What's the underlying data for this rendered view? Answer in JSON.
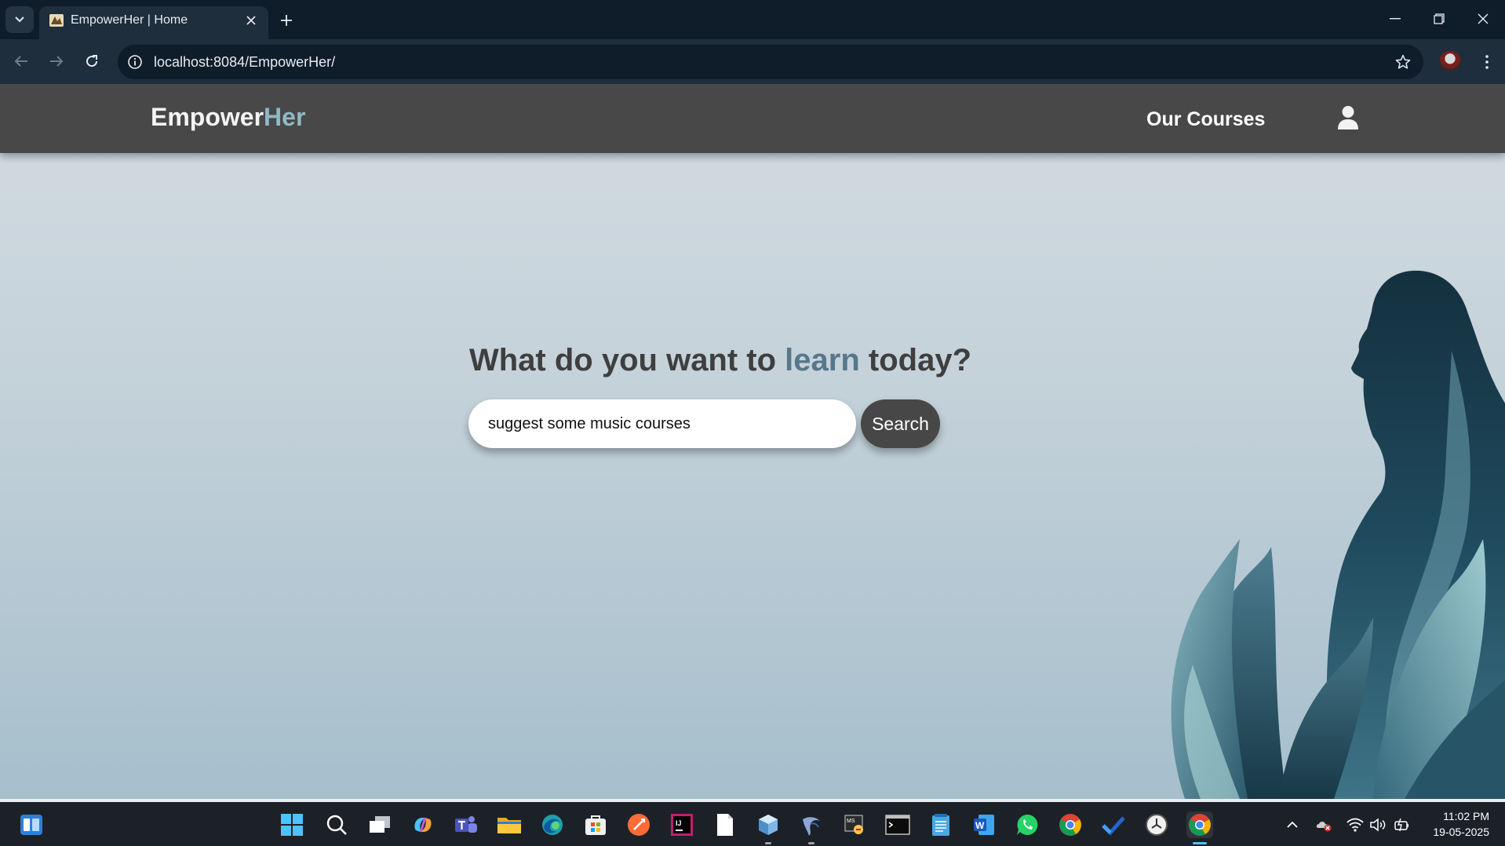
{
  "browser": {
    "tab_title": "EmpowerHer | Home",
    "url": "localhost:8084/EmpowerHer/"
  },
  "site": {
    "brand_main": "Empower",
    "brand_accent": "Her",
    "nav_courses": "Our Courses",
    "heading_before": "What do you want to ",
    "heading_accent": "learn",
    "heading_after": " today?",
    "search_value": "suggest some music courses",
    "search_button": "Search"
  },
  "taskbar": {
    "icons": [
      "windows-start",
      "search",
      "task-view",
      "copilot",
      "teams",
      "file-explorer",
      "edge",
      "microsoft-store",
      "postman",
      "intellij",
      "notepad-file",
      "virtualbox",
      "eclipse",
      "tomcat-monitor",
      "terminal",
      "notepad",
      "word",
      "whatsapp",
      "chrome",
      "todo",
      "clock-app",
      "chrome-active"
    ],
    "time": "11:02 PM",
    "date": "19-05-2025"
  },
  "colors": {
    "header_bg": "#484848",
    "brand_accent": "#8fb9c9",
    "heading_accent": "#57788a",
    "page_gradient_top": "#d3dbe1",
    "page_gradient_bottom": "#a6bfcc"
  }
}
